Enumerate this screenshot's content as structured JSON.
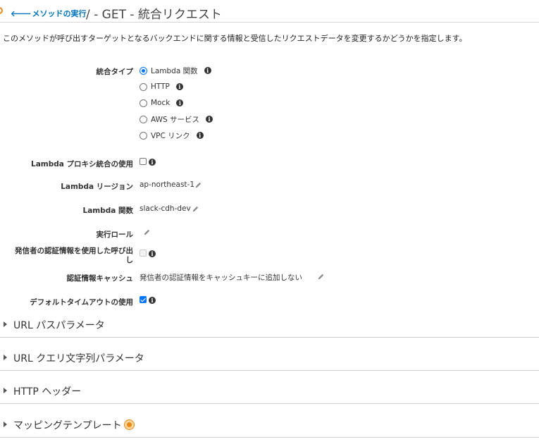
{
  "header": {
    "back_link": "メソッドの実行",
    "back_arrow": "🡐",
    "title": "/ - GET - 統合リクエスト"
  },
  "description": "このメソッドが呼び出すターゲットとなるバックエンドに関する情報と受信したリクエストデータを変更するかどうかを指定します。",
  "integration_type": {
    "label": "統合タイプ",
    "options": [
      {
        "label": "Lambda 関数",
        "selected": true
      },
      {
        "label": "HTTP",
        "selected": false
      },
      {
        "label": "Mock",
        "selected": false
      },
      {
        "label": "AWS サービス",
        "selected": false
      },
      {
        "label": "VPC リンク",
        "selected": false
      }
    ]
  },
  "fields": {
    "proxy": {
      "label": "Lambda プロキシ統合の使用",
      "checked": false
    },
    "region": {
      "label": "Lambda リージョン",
      "value": "ap-northeast-1"
    },
    "function": {
      "label": "Lambda 関数",
      "value": "slack-cdh-dev"
    },
    "role": {
      "label": "実行ロール",
      "value": ""
    },
    "caller_credentials": {
      "label_line1": "発信者の認証情報を使用した呼び出",
      "label_line2": "し",
      "checked": false
    },
    "cache": {
      "label": "認証情報キャッシュ",
      "value": "発信者の認証情報をキャッシュキーに追加しない"
    },
    "default_timeout": {
      "label": "デフォルトタイムアウトの使用",
      "checked": true
    }
  },
  "sections": [
    {
      "title": "URL パスパラメータ"
    },
    {
      "title": "URL クエリ文字列パラメータ"
    },
    {
      "title": "HTTP ヘッダー"
    },
    {
      "title": "マッピングテンプレート"
    }
  ],
  "colors": {
    "link": "#0073bb",
    "accent": "#e8891a",
    "check": "#0075ff"
  }
}
